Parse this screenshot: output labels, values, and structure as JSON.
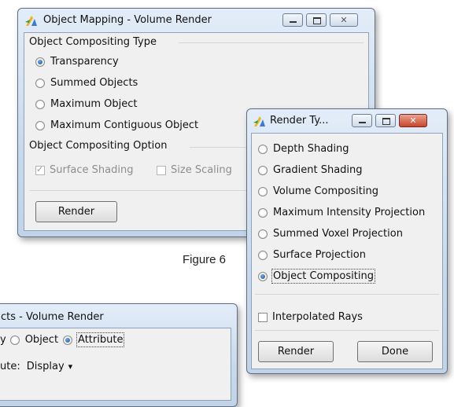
{
  "object_mapping": {
    "title": "Object Mapping - Volume Render",
    "compositing_type_header": "Object Compositing Type",
    "compositing_types": [
      {
        "label": "Transparency",
        "selected": true
      },
      {
        "label": "Summed Objects",
        "selected": false
      },
      {
        "label": "Maximum Object",
        "selected": false
      },
      {
        "label": "Maximum Contiguous Object",
        "selected": false
      }
    ],
    "compositing_option_header": "Object Compositing Option",
    "options": [
      {
        "label": "Surface Shading",
        "checked": true,
        "enabled": false
      },
      {
        "label": "Size Scaling",
        "checked": false,
        "enabled": false
      }
    ],
    "render_label": "Render"
  },
  "render_type": {
    "title": "Render Ty...",
    "types": [
      {
        "label": "Depth Shading",
        "selected": false
      },
      {
        "label": "Gradient Shading",
        "selected": false
      },
      {
        "label": "Volume Compositing",
        "selected": false
      },
      {
        "label": "Maximum Intensity Projection",
        "selected": false
      },
      {
        "label": "Summed Voxel Projection",
        "selected": false
      },
      {
        "label": "Surface Projection",
        "selected": false
      },
      {
        "label": "Object Compositing",
        "selected": true
      }
    ],
    "interpolated_rays": "Interpolated Rays",
    "render_label": "Render",
    "done_label": "Done"
  },
  "figure_caption": "Figure 6",
  "objects_window": {
    "title": "cts - Volume Render",
    "by_label": "y",
    "by_object": "Object",
    "by_attribute": "Attribute",
    "attribute_label": "ute:",
    "attribute_value": "Display",
    "attribute_arrow": "▾"
  },
  "colors": {
    "accent_radio": "#1b4f9a",
    "close_button": "#c8452d",
    "window_frame": "#c9d9ec"
  }
}
